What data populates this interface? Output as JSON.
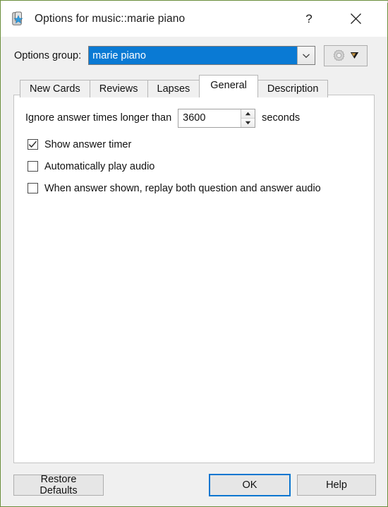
{
  "window": {
    "title": "Options for music::marie piano",
    "icon": "anki-deck-icon",
    "help_title_button": "?",
    "close_button": "✕"
  },
  "options_group": {
    "label": "Options group:",
    "value": "marie piano",
    "dropdown_arrow": "chevron-down-icon",
    "gear_button": {
      "gear_icon": "gear-icon",
      "dropdown_icon": "triangle-down-icon"
    }
  },
  "tabs": [
    {
      "label": "New Cards",
      "active": false
    },
    {
      "label": "Reviews",
      "active": false
    },
    {
      "label": "Lapses",
      "active": false
    },
    {
      "label": "General",
      "active": true
    },
    {
      "label": "Description",
      "active": false
    }
  ],
  "general_tab": {
    "ignore_row": {
      "label": "Ignore answer times longer than",
      "value": "3600",
      "suffix": "seconds",
      "up_arrow": "▲",
      "down_arrow": "▼"
    },
    "checkboxes": [
      {
        "label": "Show answer timer",
        "checked": true
      },
      {
        "label": "Automatically play audio",
        "checked": false
      },
      {
        "label": "When answer shown, replay both question and answer audio",
        "checked": false
      }
    ]
  },
  "footer": {
    "restore_defaults": "Restore Defaults",
    "ok": "OK",
    "help": "Help"
  },
  "colors": {
    "accent": "#0a7ad4",
    "focus_border": "#0a76d0",
    "window_border": "#6b8e3c",
    "dialog_bg": "#f0f0f0",
    "panel_bg": "#ffffff"
  }
}
